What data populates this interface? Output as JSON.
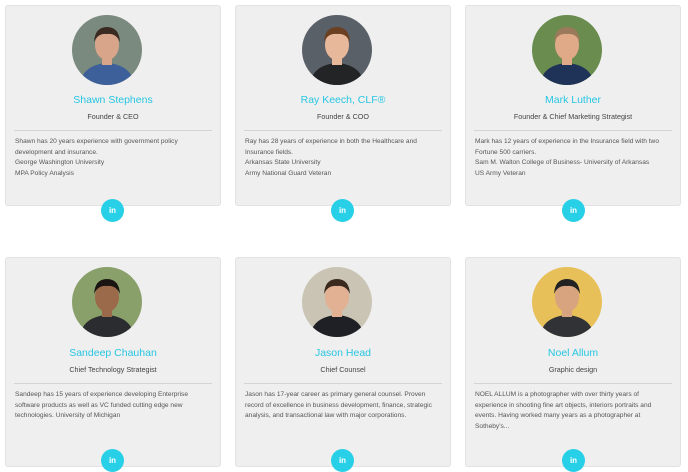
{
  "team": [
    {
      "name": "Shawn Stephens",
      "role": "Founder & CEO",
      "bio": [
        "Shawn has 20 years experience with government policy development and insurance.",
        "George Washington University",
        "MPA Policy Analysis"
      ],
      "social_label": "in",
      "colors": {
        "bg": "#7a8a7e",
        "skin": "#d9a58a",
        "hair": "#3a2a22",
        "clothes": "#3d5f9a"
      }
    },
    {
      "name": "Ray Keech, CLF®",
      "role": "Founder & COO",
      "bio": [
        "Ray has 28 years of experience in both the Healthcare and Insurance fields.",
        "Arkansas State University",
        "Army National Guard Veteran"
      ],
      "social_label": "in",
      "colors": {
        "bg": "#5a6068",
        "skin": "#e8b89a",
        "hair": "#6b3f22",
        "clothes": "#222426"
      }
    },
    {
      "name": "Mark Luther",
      "role": "Founder & Chief Marketing Strategist",
      "bio": [
        "Mark has 12 years of experience in the Insurance field with two Fortune 500 carriers.",
        "Sam M. Walton College of Business- University of Arkansas",
        "US Army Veteran"
      ],
      "social_label": "in",
      "colors": {
        "bg": "#6a8c4e",
        "skin": "#e0a988",
        "hair": "#9a7a5a",
        "clothes": "#1f3358"
      }
    },
    {
      "name": "Sandeep Chauhan",
      "role": "Chief Technology Strategist",
      "bio": [
        "Sandeep has 15 years of experience developing Enterprise software products as well as VC funded cutting edge new technologies. University of Michigan"
      ],
      "social_label": "in",
      "colors": {
        "bg": "#8aa06a",
        "skin": "#9a6a4a",
        "hair": "#1a1412",
        "clothes": "#2a2c30"
      }
    },
    {
      "name": "Jason Head",
      "role": "Chief Counsel",
      "bio": [
        "Jason has 17-year career as primary general counsel. Proven record of excellence in business development, finance, strategic analysis, and transactional law with major corporations."
      ],
      "social_label": "in",
      "colors": {
        "bg": "#c9c4b4",
        "skin": "#e2b092",
        "hair": "#3a2a1e",
        "clothes": "#1e2026"
      }
    },
    {
      "name": "Noel Allum",
      "role": "Graphic design",
      "bio": [
        "NOEL ALLUM is a photographer with over thirty years of experience in shooting fine art objects, interiors portraits and events. Having worked many years as a photographer at Sotheby's..."
      ],
      "social_label": "in",
      "colors": {
        "bg": "#e8c05a",
        "skin": "#d8a480",
        "hair": "#222222",
        "clothes": "#303236"
      }
    }
  ]
}
